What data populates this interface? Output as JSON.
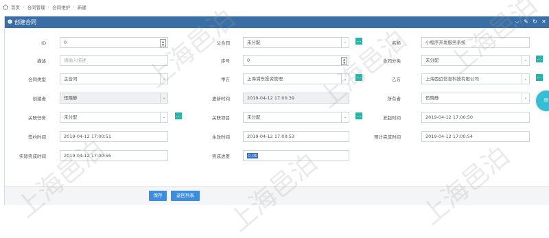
{
  "breadcrumb": [
    "首页",
    "合同管理",
    "合同维护",
    "新建"
  ],
  "panel": {
    "title": "创建合同"
  },
  "form": {
    "id": {
      "label": "ID",
      "value": "0"
    },
    "parent": {
      "label": "父合同",
      "value": "未分配"
    },
    "name": {
      "label": "名称",
      "value": "小程序开发服务系统"
    },
    "desc": {
      "label": "描述",
      "placeholder": "请输入描述"
    },
    "seq": {
      "label": "序号",
      "value": "0"
    },
    "category": {
      "label": "合同分类",
      "value": "未分配"
    },
    "ctype": {
      "label": "合同类型",
      "value": "主合同"
    },
    "party_a": {
      "label": "甲方",
      "value": "上海浦东投资管理"
    },
    "party_b": {
      "label": "乙方",
      "value": "上海西迈信息科技有限公司"
    },
    "creator": {
      "label": "创建者",
      "value": "伍晓静"
    },
    "update_time": {
      "label": "更新时间",
      "value": "2019-04-12 17:00:39"
    },
    "owner": {
      "label": "所有者",
      "value": "伍晓静"
    },
    "task": {
      "label": "关联任务",
      "value": "未分配"
    },
    "project": {
      "label": "关联项目",
      "value": "未分配"
    },
    "issue_time": {
      "label": "发起时间",
      "value": "2019-04-12 17:00:50"
    },
    "sign_time": {
      "label": "签约时间",
      "value": "2019-04-12 17:00:51"
    },
    "effect_time": {
      "label": "生效时间",
      "value": "2019-04-12 17:00:53"
    },
    "plan_done": {
      "label": "预计完成时间",
      "value": "2019-04-12 17:00:54"
    },
    "actual_done": {
      "label": "实际完成时间",
      "value": "2019-04-12 17:00:56"
    },
    "progress": {
      "label": "完成进度",
      "value": "0.00"
    }
  },
  "buttons": {
    "save": "保存",
    "back": "返回列表"
  },
  "watermark": "上海邑泊",
  "colors": {
    "header": "#3a6fa5",
    "accent": "#3c8dde",
    "add": "#28b3a9",
    "float": "#33bfd6"
  }
}
